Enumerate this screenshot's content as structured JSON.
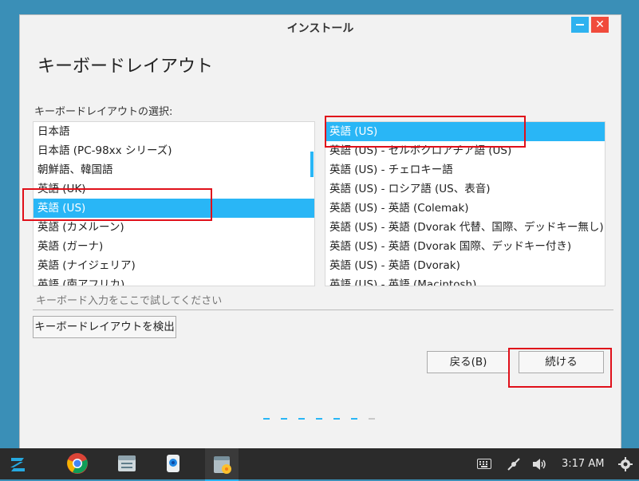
{
  "window": {
    "title": "インストール"
  },
  "page": {
    "title": "キーボードレイアウト",
    "select_label": "キーボードレイアウトの選択:"
  },
  "layouts": [
    "日本語",
    "日本語 (PC-98xx シリーズ)",
    "朝鮮語、韓国語",
    "英語 (UK)",
    "英語 (US)",
    "英語 (カメルーン)",
    "英語 (ガーナ)",
    "英語 (ナイジェリア)",
    "英語 (南アフリカ)"
  ],
  "selected_layout": "英語 (US)",
  "variants": [
    "英語 (US)",
    "英語 (US) - セルボクロアチア語 (US)",
    "英語 (US) - チェロキー語",
    "英語 (US) - ロシア語 (US、表音)",
    "英語 (US) - 英語 (Colemak)",
    "英語 (US) - 英語 (Dvorak 代替、国際、デッドキー無し)",
    "英語 (US) - 英語 (Dvorak 国際、デッドキー付き)",
    "英語 (US) - 英語 (Dvorak)",
    "英語 (US) - 英語 (Macintosh)"
  ],
  "selected_variant": "英語 (US)",
  "test_input": {
    "placeholder": "キーボード入力をここで試してください",
    "value": ""
  },
  "buttons": {
    "detect": "キーボードレイアウトを検出",
    "back": "戻る(B)",
    "continue": "続ける"
  },
  "progress": {
    "total_steps": 7,
    "current_step": 6
  },
  "taskbar": {
    "apps": [
      "zorin-menu",
      "chrome",
      "file-manager",
      "webcam",
      "installer"
    ],
    "clock": "3:17 AM"
  },
  "colors": {
    "accent": "#29b6f6",
    "highlight_box": "#e0101a",
    "close": "#f04b3c",
    "taskbar": "#2b2b2b"
  }
}
